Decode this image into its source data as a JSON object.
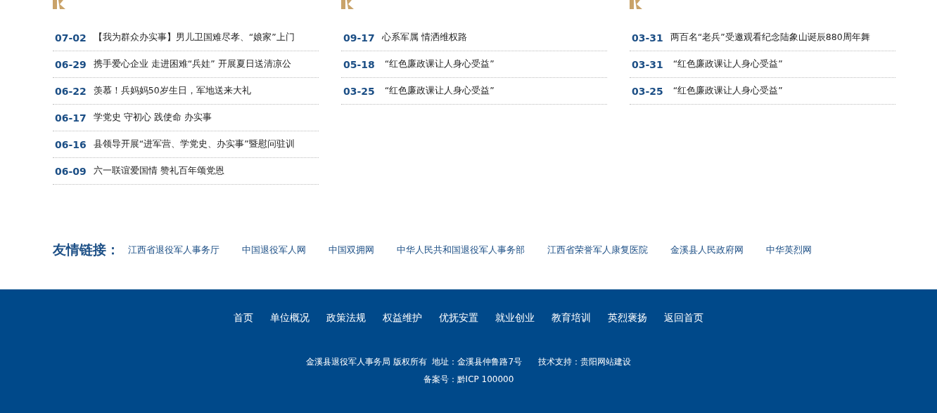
{
  "columns": [
    {
      "items": [
        {
          "date": "07-02",
          "title": "【我为群众办实事】男儿卫国难尽孝、“娘家”上门"
        },
        {
          "date": "06-29",
          "title": "携手爱心企业 走进困难“兵娃” 开展夏日送清凉公"
        },
        {
          "date": "06-22",
          "title": "羡慕！兵妈妈50岁生日，军地送来大礼"
        },
        {
          "date": "06-17",
          "title": "学党史 守初心 践使命 办实事"
        },
        {
          "date": "06-16",
          "title": "县领导开展“进军营、学党史、办实事”暨慰问驻训"
        },
        {
          "date": "06-09",
          "title": "六一联谊爱国情 赞礼百年颂党恩"
        }
      ]
    },
    {
      "items": [
        {
          "date": "09-17",
          "title": "心系军属 情洒维权路"
        },
        {
          "date": "05-18",
          "title": " “红色廉政课让人身心受益”"
        },
        {
          "date": "03-25",
          "title": " “红色廉政课让人身心受益”"
        }
      ]
    },
    {
      "items": [
        {
          "date": "03-31",
          "title": "两百名“老兵”受邀观看纪念陆象山诞辰880周年舞"
        },
        {
          "date": "03-31",
          "title": " “红色廉政课让人身心受益”"
        },
        {
          "date": "03-25",
          "title": " “红色廉政课让人身心受益”"
        }
      ]
    }
  ],
  "friend_links": {
    "title": "友情链接：",
    "links": [
      "江西省退役军人事务厅",
      "中国退役军人网",
      "中国双拥网",
      "中华人民共和国退役军人事务部",
      "江西省荣誉军人康复医院",
      "金溪县人民政府网",
      "中华英烈网"
    ]
  },
  "footer": {
    "nav": [
      "首页",
      "单位概况",
      "政策法规",
      "权益维护",
      "优抚安置",
      "就业创业",
      "教育培训",
      "英烈褒扬",
      "返回首页"
    ],
    "copyright": "金溪县退役军人事务局 版权所有  地址：金溪县仲鲁路7号      技术支持：贵阳网站建设",
    "record": "备案号：黔ICP 100000"
  }
}
